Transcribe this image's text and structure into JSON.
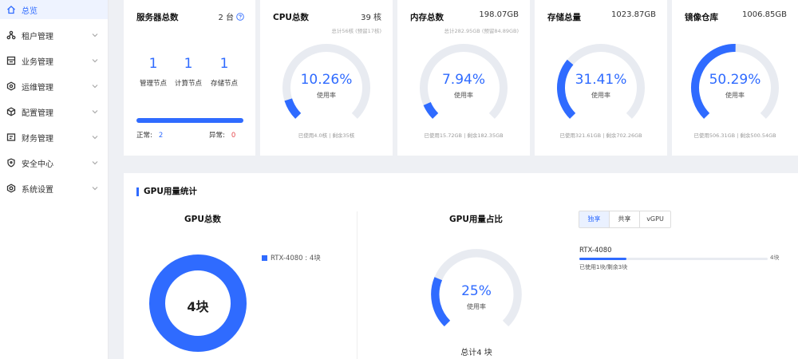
{
  "sidebar": {
    "items": [
      {
        "label": "总览",
        "icon": "home-icon",
        "active": true
      },
      {
        "label": "租户管理",
        "icon": "tenant-icon"
      },
      {
        "label": "业务管理",
        "icon": "business-icon"
      },
      {
        "label": "运维管理",
        "icon": "ops-icon"
      },
      {
        "label": "配置管理",
        "icon": "config-icon"
      },
      {
        "label": "财务管理",
        "icon": "finance-icon"
      },
      {
        "label": "安全中心",
        "icon": "shield-icon"
      },
      {
        "label": "系统设置",
        "icon": "settings-icon"
      }
    ]
  },
  "servers": {
    "title": "服务器总数",
    "total": "2 台",
    "nodes": [
      {
        "count": "1",
        "label": "管理节点"
      },
      {
        "count": "1",
        "label": "计算节点"
      },
      {
        "count": "1",
        "label": "存储节点"
      }
    ],
    "normal_label": "正常:",
    "normal_count": "2",
    "abnormal_label": "异常:",
    "abnormal_count": "0"
  },
  "cards": {
    "cpu": {
      "title": "CPU总数",
      "value": "39 核",
      "sub": "总计56核 (预留17核)",
      "percent": "10.26%",
      "ratio": 0.1026,
      "usage_label": "使用率",
      "foot": "已使用4.0核 | 剩余35核"
    },
    "memory": {
      "title": "内存总数",
      "value": "198.07GB",
      "sub": "总计282.95GB (预留84.89GB)",
      "percent": "7.94%",
      "ratio": 0.0794,
      "usage_label": "使用率",
      "foot": "已使用15.72GB | 剩余182.35GB"
    },
    "storage": {
      "title": "存储总量",
      "value": "1023.87GB",
      "percent": "31.41%",
      "ratio": 0.3141,
      "usage_label": "使用率",
      "foot": "已使用321.61GB | 剩余702.26GB"
    },
    "image": {
      "title": "镜像仓库",
      "value": "1006.85GB",
      "percent": "50.29%",
      "ratio": 0.5029,
      "usage_label": "使用率",
      "foot": "已使用506.31GB | 剩余500.54GB"
    }
  },
  "gpu": {
    "section_title": "GPU用量统计",
    "total_title": "GPU总数",
    "total_center": "4块",
    "legend_label": "RTX-4080 : 4块",
    "usage_title": "GPU用量占比",
    "usage_percent": "25%",
    "usage_ratio": 0.25,
    "usage_label": "使用率",
    "total_label": "总计4 块",
    "tabs": [
      "独享",
      "共享",
      "vGPU"
    ],
    "active_tab": 0,
    "row": {
      "name": "RTX-4080",
      "count": "4块",
      "used_text": "已使用1块/剩余3块",
      "ratio": 0.25
    }
  },
  "colors": {
    "accent": "#2f6bff",
    "track": "#e8ebf1",
    "danger": "#e5484d"
  }
}
